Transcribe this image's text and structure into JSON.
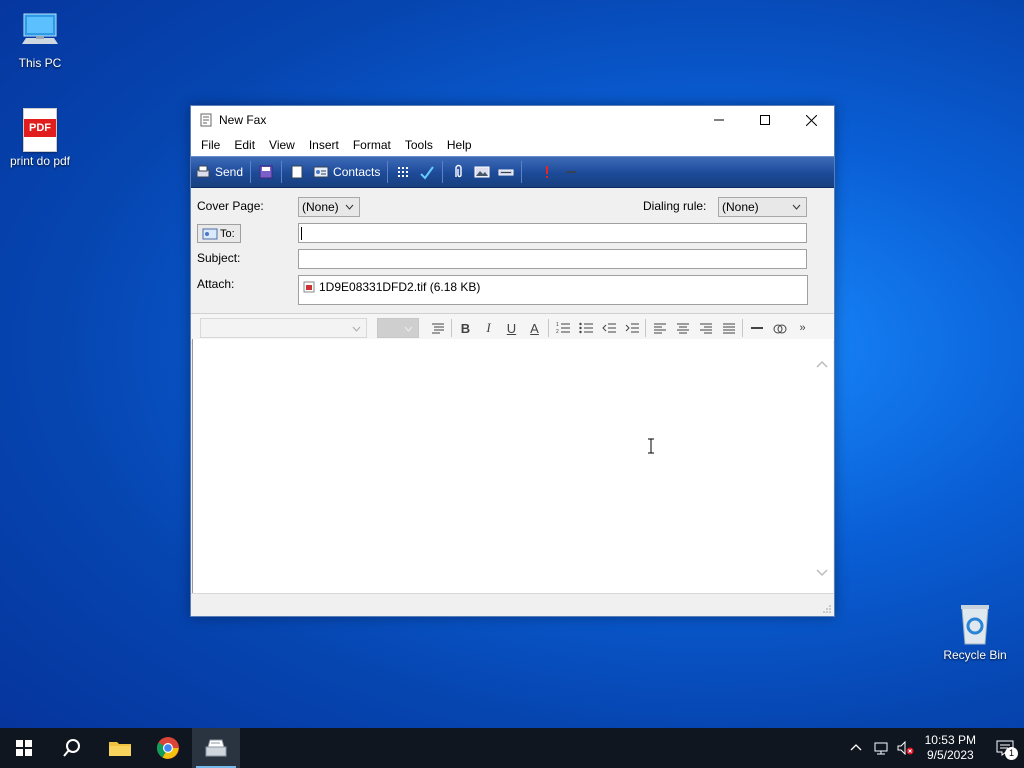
{
  "desktop": {
    "icons": [
      {
        "label": "This PC"
      },
      {
        "label": "print do pdf",
        "badge": "PDF"
      },
      {
        "label": "Recycle Bin"
      }
    ]
  },
  "window": {
    "title": "New Fax",
    "menu": [
      "File",
      "Edit",
      "View",
      "Insert",
      "Format",
      "Tools",
      "Help"
    ],
    "toolbar": {
      "send": "Send",
      "contacts": "Contacts"
    },
    "form": {
      "cover_page_label": "Cover Page:",
      "cover_page_value": "(None)",
      "dialing_rule_label": "Dialing rule:",
      "dialing_rule_value": "(None)",
      "to_button": "To:",
      "to_value": "",
      "subject_label": "Subject:",
      "subject_value": "",
      "attach_label": "Attach:",
      "attachment": "1D9E08331DFD2.tif (6.18 KB)"
    },
    "format_bar": {
      "bold": "B",
      "italic": "I",
      "underline": "U",
      "font_color": "A",
      "more": "»"
    }
  },
  "taskbar": {
    "time": "10:53 PM",
    "date": "9/5/2023",
    "notification_count": "1"
  },
  "colors": {
    "accent": "#0a5fd6",
    "toolbar": "#1d4a98",
    "taskbar": "#0f1620"
  }
}
